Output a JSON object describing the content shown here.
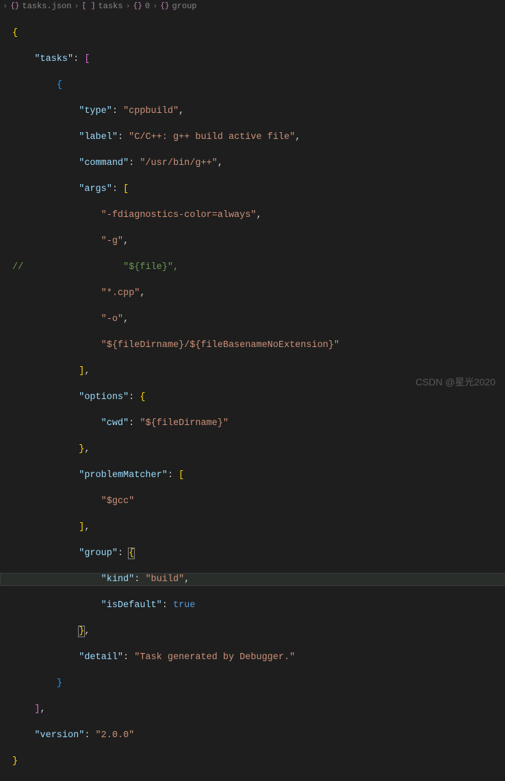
{
  "breadcrumb": {
    "file_icon": "{}",
    "file": "tasks.json",
    "p1_icon": "[ ]",
    "p1": "tasks",
    "p2_icon": "{}",
    "p2": "0",
    "p3_icon": "{}",
    "p3": "group"
  },
  "code": {
    "l1": "{",
    "l2_key": "\"tasks\"",
    "l2_punc": ": ",
    "l2_br": "[",
    "l3_br": "{",
    "l4_key": "\"type\"",
    "l4_punc": ": ",
    "l4_val": "\"cppbuild\"",
    "l4_c": ",",
    "l5_key": "\"label\"",
    "l5_punc": ": ",
    "l5_val": "\"C/C++: g++ build active file\"",
    "l5_c": ",",
    "l6_key": "\"command\"",
    "l6_punc": ": ",
    "l6_val": "\"/usr/bin/g++\"",
    "l6_c": ",",
    "l7_key": "\"args\"",
    "l7_punc": ": ",
    "l7_br": "[",
    "l8_val": "\"-fdiagnostics-color=always\"",
    "l8_c": ",",
    "l9_val": "\"-g\"",
    "l9_c": ",",
    "l10_comment": "//",
    "l10_val": "\"${file}\",",
    "l11_val": "\"*.cpp\"",
    "l11_c": ",",
    "l12_val": "\"-o\"",
    "l12_c": ",",
    "l13_val": "\"${fileDirname}/${fileBasenameNoExtension}\"",
    "l14_br": "]",
    "l14_c": ",",
    "l15_key": "\"options\"",
    "l15_punc": ": ",
    "l15_br": "{",
    "l16_key": "\"cwd\"",
    "l16_punc": ": ",
    "l16_val": "\"${fileDirname}\"",
    "l17_br": "}",
    "l17_c": ",",
    "l18_key": "\"problemMatcher\"",
    "l18_punc": ": ",
    "l18_br": "[",
    "l19_val": "\"$gcc\"",
    "l20_br": "]",
    "l20_c": ",",
    "l21_key": "\"group\"",
    "l21_punc": ": ",
    "l21_br": "{",
    "l22_key": "\"kind\"",
    "l22_punc": ": ",
    "l22_val": "\"build\"",
    "l22_c": ",",
    "l23_key": "\"isDefault\"",
    "l23_punc": ": ",
    "l23_val": "true",
    "l24_br": "}",
    "l24_c": ",",
    "l25_key": "\"detail\"",
    "l25_punc": ": ",
    "l25_val": "\"Task generated by Debugger.\"",
    "l26_br": "}",
    "l27_br": "]",
    "l27_c": ",",
    "l28_key": "\"version\"",
    "l28_punc": ": ",
    "l28_val": "\"2.0.0\"",
    "l29": "}"
  },
  "watermark": "CSDN @星光2020",
  "chart_data": {
    "type": "table",
    "title": "tasks.json",
    "data": {
      "version": "2.0.0",
      "tasks": [
        {
          "type": "cppbuild",
          "label": "C/C++: g++ build active file",
          "command": "/usr/bin/g++",
          "args": [
            "-fdiagnostics-color=always",
            "-g",
            "*.cpp",
            "-o",
            "${fileDirname}/${fileBasenameNoExtension}"
          ],
          "options": {
            "cwd": "${fileDirname}"
          },
          "problemMatcher": [
            "$gcc"
          ],
          "group": {
            "kind": "build",
            "isDefault": true
          },
          "detail": "Task generated by Debugger."
        }
      ]
    }
  }
}
